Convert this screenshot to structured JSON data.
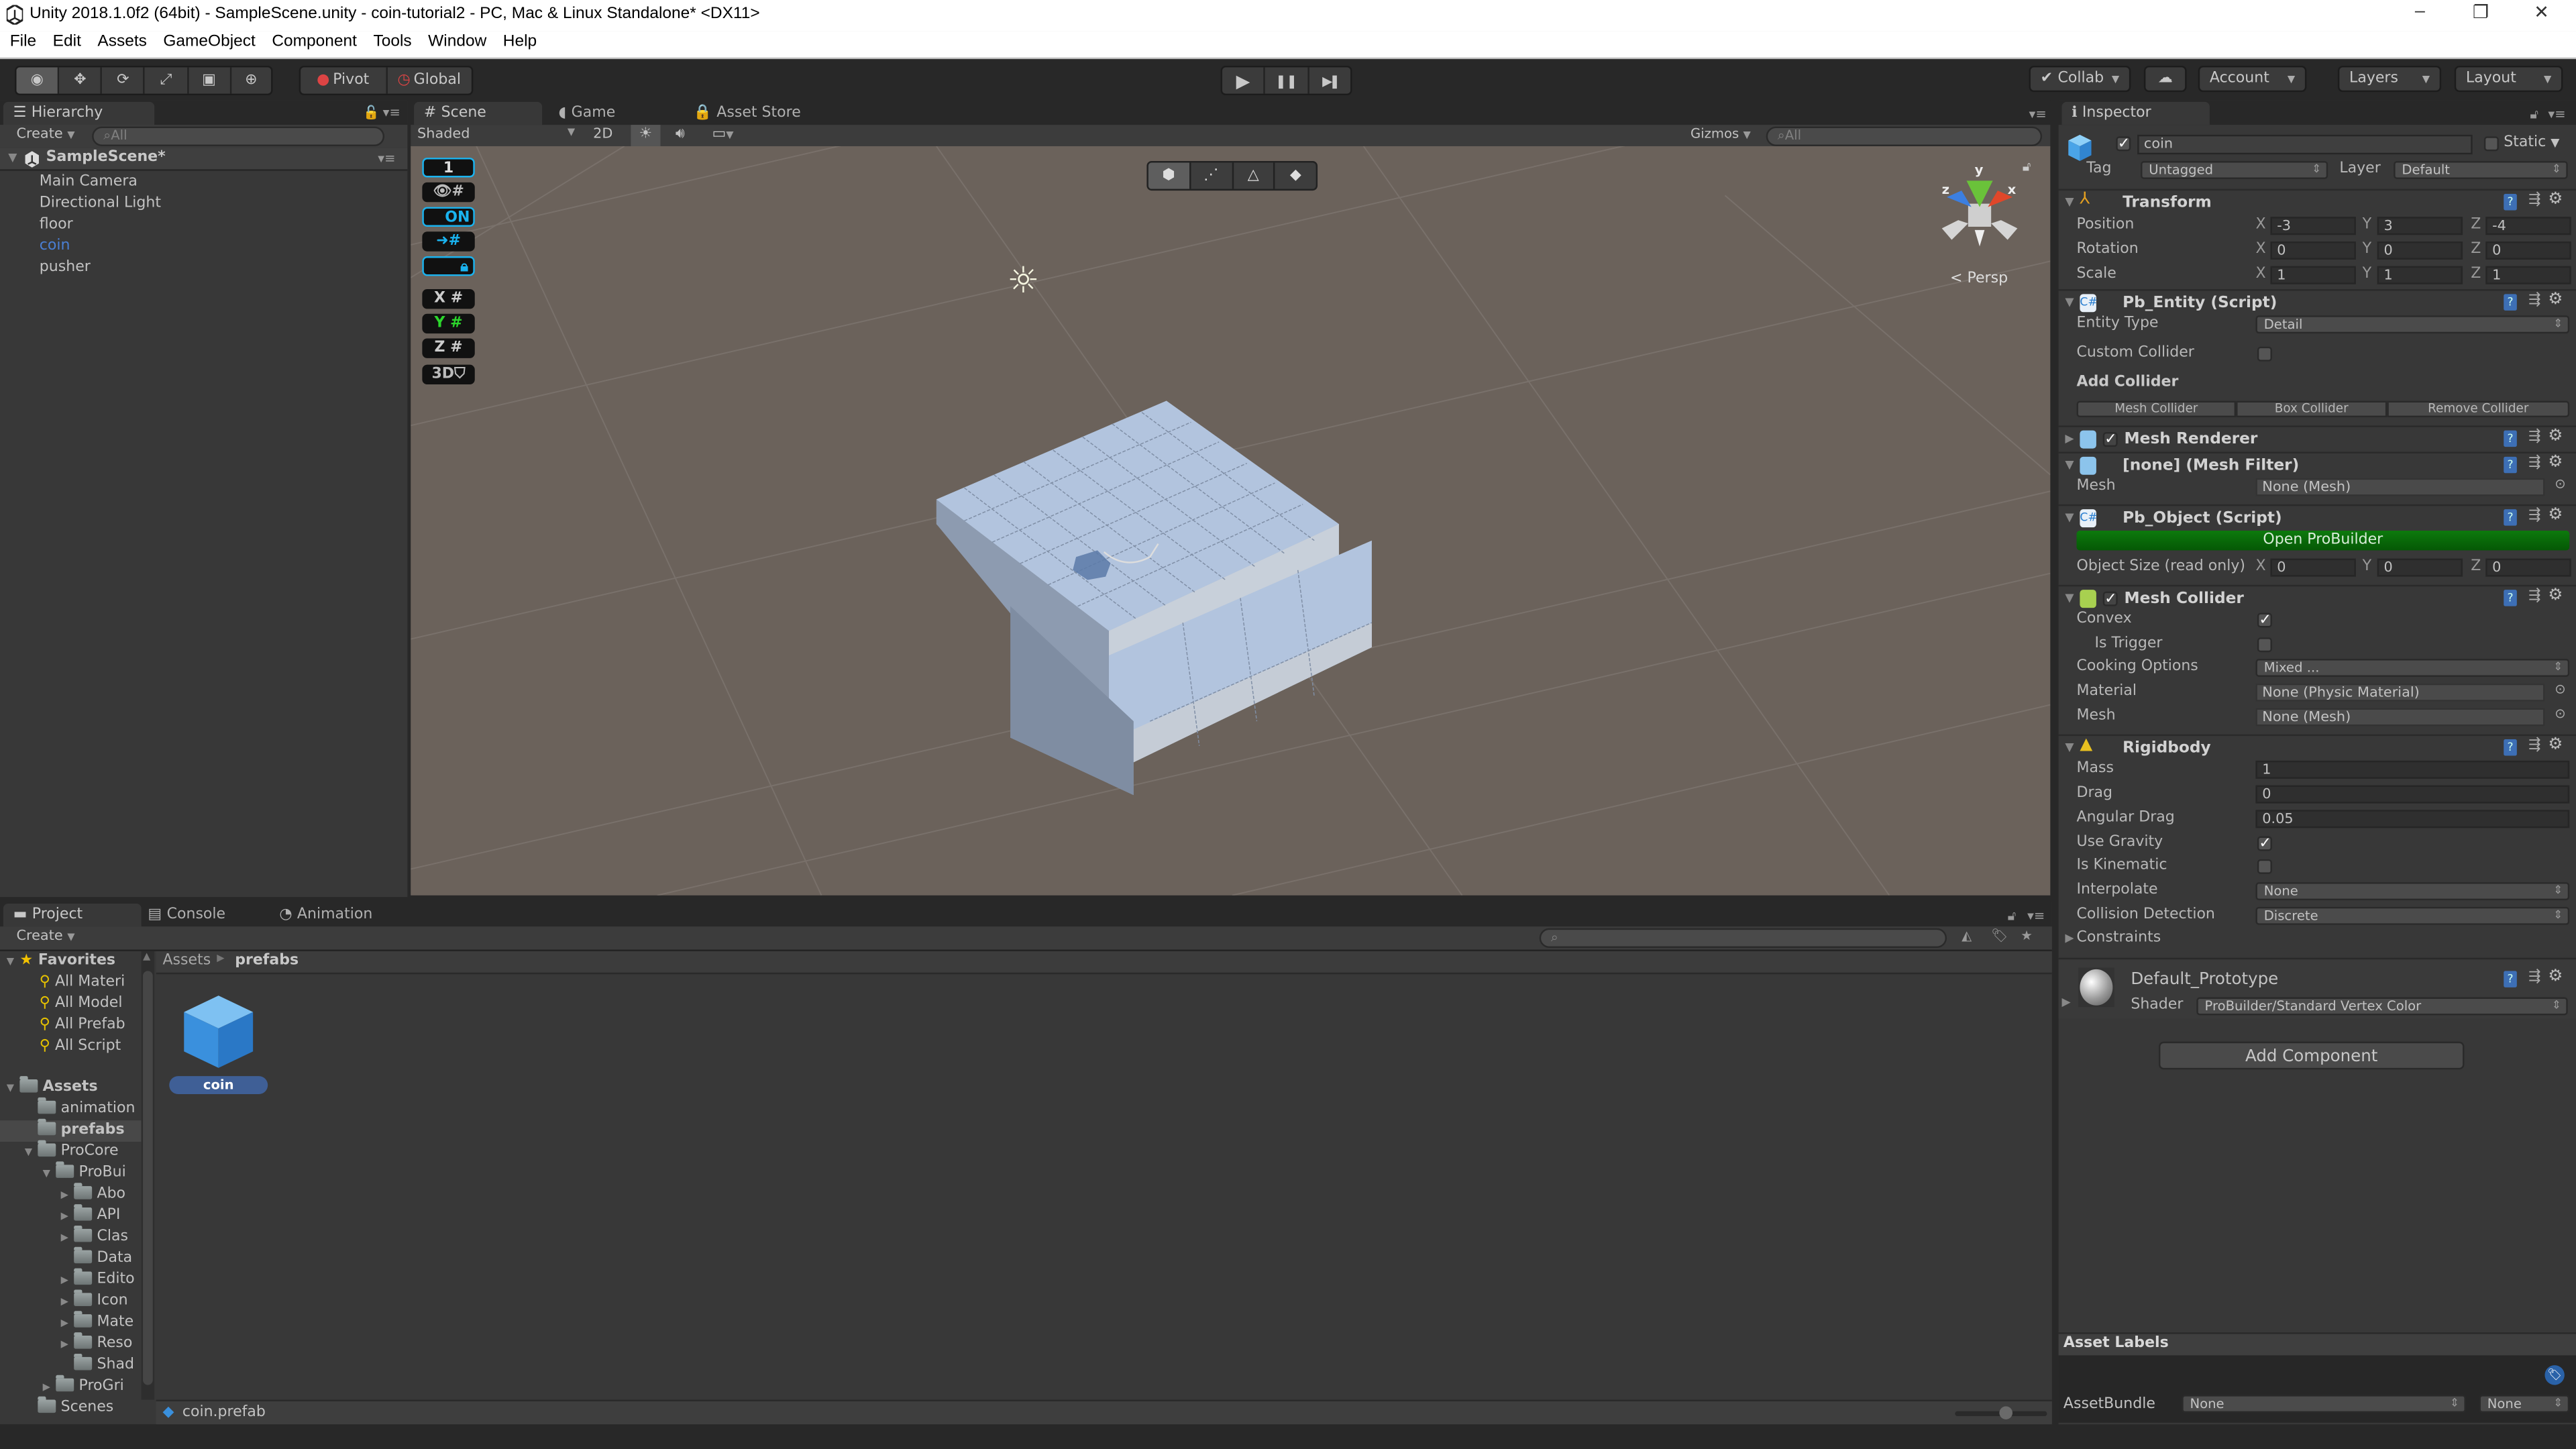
{
  "window": {
    "title": "Unity 2018.1.0f2 (64bit) - SampleScene.unity - coin-tutorial2 - PC, Mac & Linux Standalone* <DX11>",
    "minimize": "–",
    "maximize": "❐",
    "close": "✕"
  },
  "menu": [
    "File",
    "Edit",
    "Assets",
    "GameObject",
    "Component",
    "Tools",
    "Window",
    "Help"
  ],
  "toolbar": {
    "tools": [
      "view-tool",
      "move-tool",
      "rotate-tool",
      "scale-tool",
      "rect-tool",
      "transform-tool"
    ],
    "tool_glyphs": [
      "◉",
      "✥",
      "⟳",
      "⤢",
      "▣",
      "⊕"
    ],
    "pivot": "Pivot",
    "global": "Global",
    "play": "▶",
    "pause": "❚❚",
    "step": "▶❚",
    "collab": "Collab",
    "account": "Account",
    "layers": "Layers",
    "layout": "Layout"
  },
  "hierarchy": {
    "tab": "Hierarchy",
    "create": "Create",
    "search_placeholder": "All",
    "scene": "SampleScene*",
    "items": [
      {
        "label": "Main Camera",
        "selected": false
      },
      {
        "label": "Directional Light",
        "selected": false
      },
      {
        "label": "floor",
        "selected": false
      },
      {
        "label": "coin",
        "selected": true
      },
      {
        "label": "pusher",
        "selected": false
      }
    ]
  },
  "scene": {
    "tabs": [
      "Scene",
      "Game",
      "Asset Store"
    ],
    "shading": "Shaded",
    "mode_2d": "2D",
    "gizmos": "Gizmos",
    "search_placeholder": "All",
    "projection": "Persp",
    "gizmo_axes": [
      "y",
      "z",
      "x"
    ],
    "progrids": {
      "snap_value": "1",
      "toggle_on": "ON",
      "axes": [
        "X",
        "Y",
        "Z"
      ],
      "mode_3d": "3D"
    }
  },
  "project": {
    "tabs": [
      "Project",
      "Console",
      "Animation"
    ],
    "create": "Create",
    "favorites_label": "Favorites",
    "favorites": [
      "All Materi",
      "All Model",
      "All Prefab",
      "All Script"
    ],
    "assets_label": "Assets",
    "tree": [
      {
        "label": "animation",
        "depth": 1,
        "expander": ""
      },
      {
        "label": "prefabs",
        "depth": 1,
        "expander": "",
        "selected": true
      },
      {
        "label": "ProCore",
        "depth": 1,
        "expander": "▼"
      },
      {
        "label": "ProBui",
        "depth": 2,
        "expander": "▼"
      },
      {
        "label": "Abo",
        "depth": 3,
        "expander": "▶"
      },
      {
        "label": "API",
        "depth": 3,
        "expander": "▶"
      },
      {
        "label": "Clas",
        "depth": 3,
        "expander": "▶"
      },
      {
        "label": "Data",
        "depth": 3,
        "expander": ""
      },
      {
        "label": "Edito",
        "depth": 3,
        "expander": "▶"
      },
      {
        "label": "Icon",
        "depth": 3,
        "expander": "▶"
      },
      {
        "label": "Mate",
        "depth": 3,
        "expander": "▶"
      },
      {
        "label": "Reso",
        "depth": 3,
        "expander": "▶"
      },
      {
        "label": "Shad",
        "depth": 3,
        "expander": ""
      },
      {
        "label": "ProGri",
        "depth": 2,
        "expander": "▶"
      },
      {
        "label": "Scenes",
        "depth": 1,
        "expander": ""
      }
    ],
    "breadcrumb": [
      "Assets",
      "prefabs"
    ],
    "asset_name": "coin",
    "selected_path": "coin.prefab",
    "zoom_slider": 0.55
  },
  "inspector": {
    "tab": "Inspector",
    "object_name": "coin",
    "active": true,
    "static_label": "Static",
    "static": false,
    "tag_label": "Tag",
    "tag": "Untagged",
    "layer_label": "Layer",
    "layer": "Default",
    "transform": {
      "title": "Transform",
      "rows": [
        {
          "label": "Position",
          "x": "-3",
          "y": "3",
          "z": "-4"
        },
        {
          "label": "Rotation",
          "x": "0",
          "y": "0",
          "z": "0"
        },
        {
          "label": "Scale",
          "x": "1",
          "y": "1",
          "z": "1"
        }
      ]
    },
    "pb_entity": {
      "title": "Pb_Entity (Script)",
      "entity_type_label": "Entity Type",
      "entity_type": "Detail",
      "custom_collider_label": "Custom Collider",
      "custom_collider": false,
      "add_collider_label": "Add Collider",
      "buttons": [
        "Mesh Collider",
        "Box Collider",
        "Remove Collider"
      ]
    },
    "mesh_renderer": {
      "title": "Mesh Renderer",
      "enabled": true
    },
    "mesh_filter": {
      "title": "[none] (Mesh Filter)",
      "mesh_label": "Mesh",
      "mesh": "None (Mesh)"
    },
    "pb_object": {
      "title": "Pb_Object (Script)",
      "open_button": "Open ProBuilder",
      "size_label": "Object Size (read only)",
      "x": "0",
      "y": "0",
      "z": "0"
    },
    "mesh_collider": {
      "title": "Mesh Collider",
      "enabled": true,
      "convex_label": "Convex",
      "convex": true,
      "trigger_label": "Is Trigger",
      "trigger": false,
      "cooking_label": "Cooking Options",
      "cooking": "Mixed ...",
      "material_label": "Material",
      "material": "None (Physic Material)",
      "mesh_label": "Mesh",
      "mesh": "None (Mesh)"
    },
    "rigidbody": {
      "title": "Rigidbody",
      "mass_label": "Mass",
      "mass": "1",
      "drag_label": "Drag",
      "drag": "0",
      "angular_drag_label": "Angular Drag",
      "angular_drag": "0.05",
      "gravity_label": "Use Gravity",
      "gravity": true,
      "kinematic_label": "Is Kinematic",
      "kinematic": false,
      "interpolate_label": "Interpolate",
      "interpolate": "None",
      "collision_label": "Collision Detection",
      "collision": "Discrete",
      "constraints_label": "Constraints"
    },
    "material": {
      "name": "Default_Prototype",
      "shader_label": "Shader",
      "shader": "ProBuilder/Standard Vertex Color"
    },
    "add_component": "Add Component",
    "asset_labels": "Asset Labels",
    "asset_bundle_label": "AssetBundle",
    "asset_bundle": "None",
    "asset_bundle_variant": "None"
  },
  "colors": {
    "selection_blue": "#4a7fd4",
    "probuilder_green": "#0a6b0a",
    "scene_bg": "#6b625b",
    "progrids_accent": "#1ab3ef"
  }
}
